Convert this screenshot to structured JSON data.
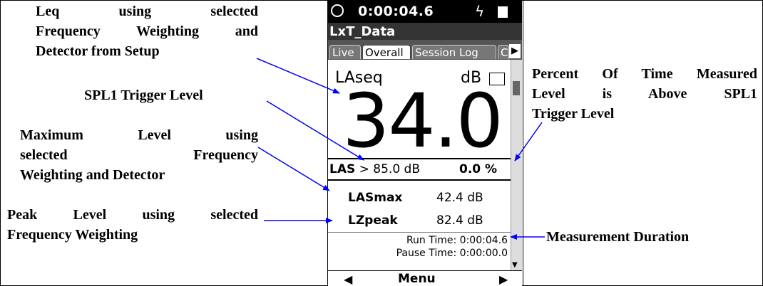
{
  "annotations": {
    "leq": [
      "Leq using selected",
      "Frequency Weighting and",
      "Detector from Setup"
    ],
    "spl1": "SPL1 Trigger Level",
    "maximum": [
      "Maximum Level using",
      "selected Frequency",
      "Weighting and Detector"
    ],
    "peak": [
      "Peak Level using selected",
      "Frequency Weighting"
    ],
    "percent": [
      "Percent Of Time Measured",
      "Level is Above SPL1",
      "Trigger Level"
    ],
    "duration": "Measurement Duration"
  },
  "device": {
    "status_time": "0:00:04.6",
    "title": "LxT_Data",
    "tabs": [
      "Live",
      "Overall",
      "Session Log",
      "C"
    ],
    "active_tab": "Overall",
    "measurement_label": "LAseq",
    "measurement_unit": "dB",
    "leq_value": "34.0",
    "trigger_label": "LAS",
    "trigger_op": ">",
    "trigger_value": "85.0 dB",
    "percent_value": "0.0 %",
    "max_label": "LASmax",
    "max_value": "42.4 dB",
    "peak_label": "LZpeak",
    "peak_value": "82.4 dB",
    "run_time": "Run Time:  0:00:04.6",
    "pause_time": "Pause Time:  0:00:00.0",
    "menu": "Menu"
  },
  "colors": {
    "arrow": "#0000ff",
    "status_bar": "#000000",
    "title_bar": "#333333"
  }
}
